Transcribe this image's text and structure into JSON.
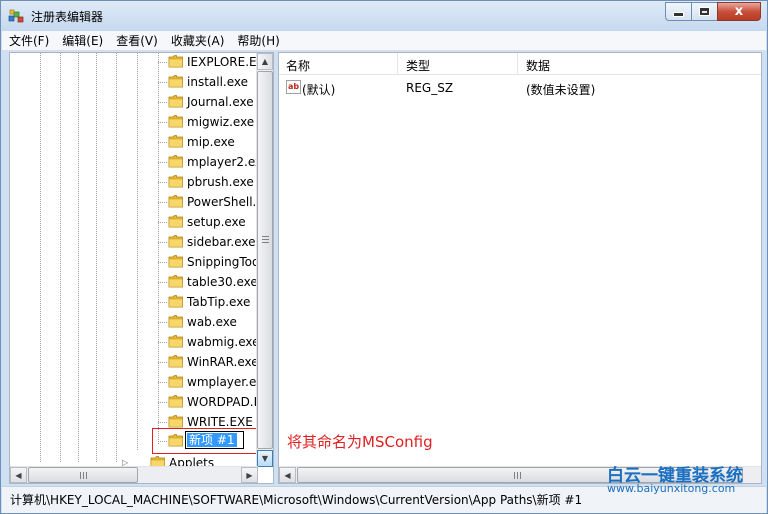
{
  "window": {
    "title": "注册表编辑器",
    "close_glyph": "x"
  },
  "menubar": {
    "items": [
      "文件(F)",
      "编辑(E)",
      "查看(V)",
      "收藏夹(A)",
      "帮助(H)"
    ]
  },
  "tree": {
    "items": [
      "IEXPLORE.E",
      "install.exe",
      "Journal.exe",
      "migwiz.exe",
      "mip.exe",
      "mplayer2.ex",
      "pbrush.exe",
      "PowerShell.",
      "setup.exe",
      "sidebar.exe",
      "SnippingToo",
      "table30.exe",
      "TabTip.exe",
      "wab.exe",
      "wabmig.exe",
      "WinRAR.exe",
      "wmplayer.ex",
      "WORDPAD.I",
      "WRITE.EXE"
    ],
    "renaming_value": "新项 #1",
    "next_item": "Applets"
  },
  "list": {
    "columns": [
      "名称",
      "类型",
      "数据"
    ],
    "rows": [
      {
        "name": "(默认)",
        "type": "REG_SZ",
        "data": "(数值未设置)",
        "icon": "string-value-icon"
      }
    ],
    "icon_text": "ab"
  },
  "annotation": "将其命名为MSConfig",
  "status": {
    "path": "计算机\\HKEY_LOCAL_MACHINE\\SOFTWARE\\Microsoft\\Windows\\CurrentVersion\\App Paths\\新项 #1"
  },
  "watermark": {
    "name": "白云一键重装系统",
    "url": "www.baiyunxitong.com"
  },
  "colors": {
    "annotation": "#e02020",
    "selection": "#3399ff",
    "watermark": "#1b6fc0",
    "folder": "#f2c94c"
  }
}
